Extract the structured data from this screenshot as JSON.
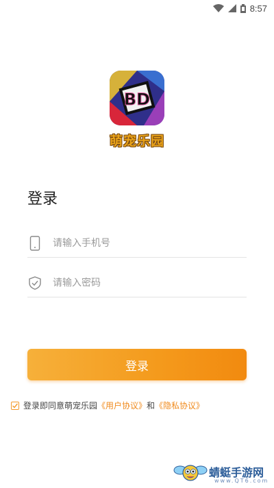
{
  "status_bar": {
    "time": "8:57",
    "icons": [
      "wifi-icon",
      "signal-icon",
      "battery-icon"
    ]
  },
  "app": {
    "name": "萌宠乐园",
    "logo_text": "BD"
  },
  "login": {
    "title": "登录",
    "phone_placeholder": "请输入手机号",
    "password_placeholder": "请输入密码",
    "submit_label": "登录"
  },
  "agreement": {
    "checked": true,
    "prefix": "登录即同意萌宠乐园",
    "user_agreement": "《用户协议》",
    "conjunction": "和",
    "privacy_policy": "《隐私协议》"
  },
  "colors": {
    "accent": "#f49a1c",
    "link": "#f08a1c"
  },
  "watermark": {
    "title": "蜻蜓手游网",
    "subtitle": "www.QT6.com"
  }
}
